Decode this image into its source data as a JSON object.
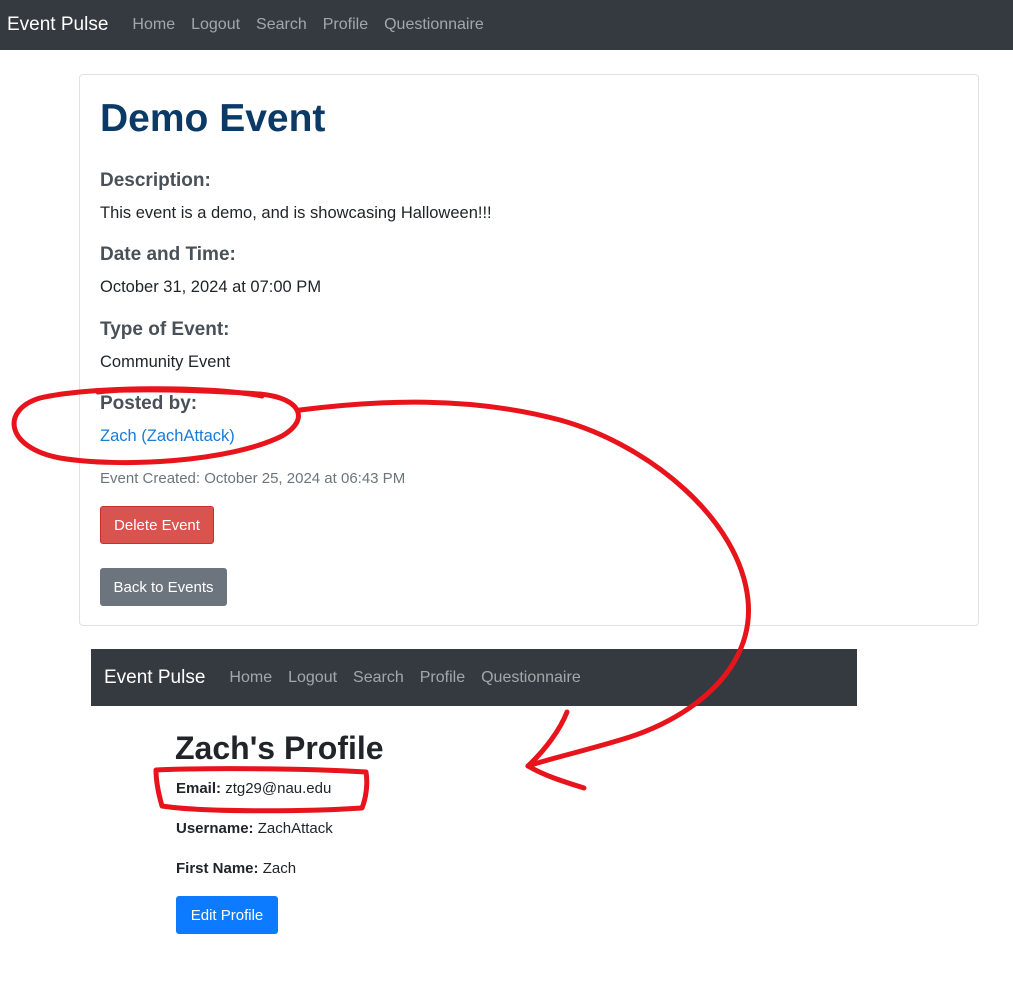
{
  "top_nav": {
    "brand": "Event Pulse",
    "links": [
      "Home",
      "Logout",
      "Search",
      "Profile",
      "Questionnaire"
    ]
  },
  "event": {
    "title": "Demo Event",
    "description_label": "Description:",
    "description": "This event is a demo, and is showcasing Halloween!!!",
    "datetime_label": "Date and Time:",
    "datetime": "October 31, 2024 at 07:00 PM",
    "type_label": "Type of Event:",
    "type": "Community Event",
    "posted_by_label": "Posted by:",
    "posted_by": "Zach (ZachAttack)",
    "created": "Event Created: October 25, 2024 at 06:43 PM",
    "delete_label": "Delete Event",
    "back_label": "Back to Events"
  },
  "bottom_nav": {
    "brand": "Event Pulse",
    "links": [
      "Home",
      "Logout",
      "Search",
      "Profile",
      "Questionnaire"
    ]
  },
  "profile": {
    "title": "Zach's Profile",
    "email_label": "Email:",
    "email": "ztg29@nau.edu",
    "username_label": "Username:",
    "username": "ZachAttack",
    "first_name_label": "First Name:",
    "first_name": "Zach",
    "edit_label": "Edit Profile"
  },
  "colors": {
    "navbar_bg": "#343a40",
    "title_blue": "#0b3a66",
    "link_blue": "#1a7bd6",
    "danger": "#d9534f",
    "secondary": "#6c757d",
    "primary": "#0d7bff",
    "annotation_red": "#e8141c"
  }
}
